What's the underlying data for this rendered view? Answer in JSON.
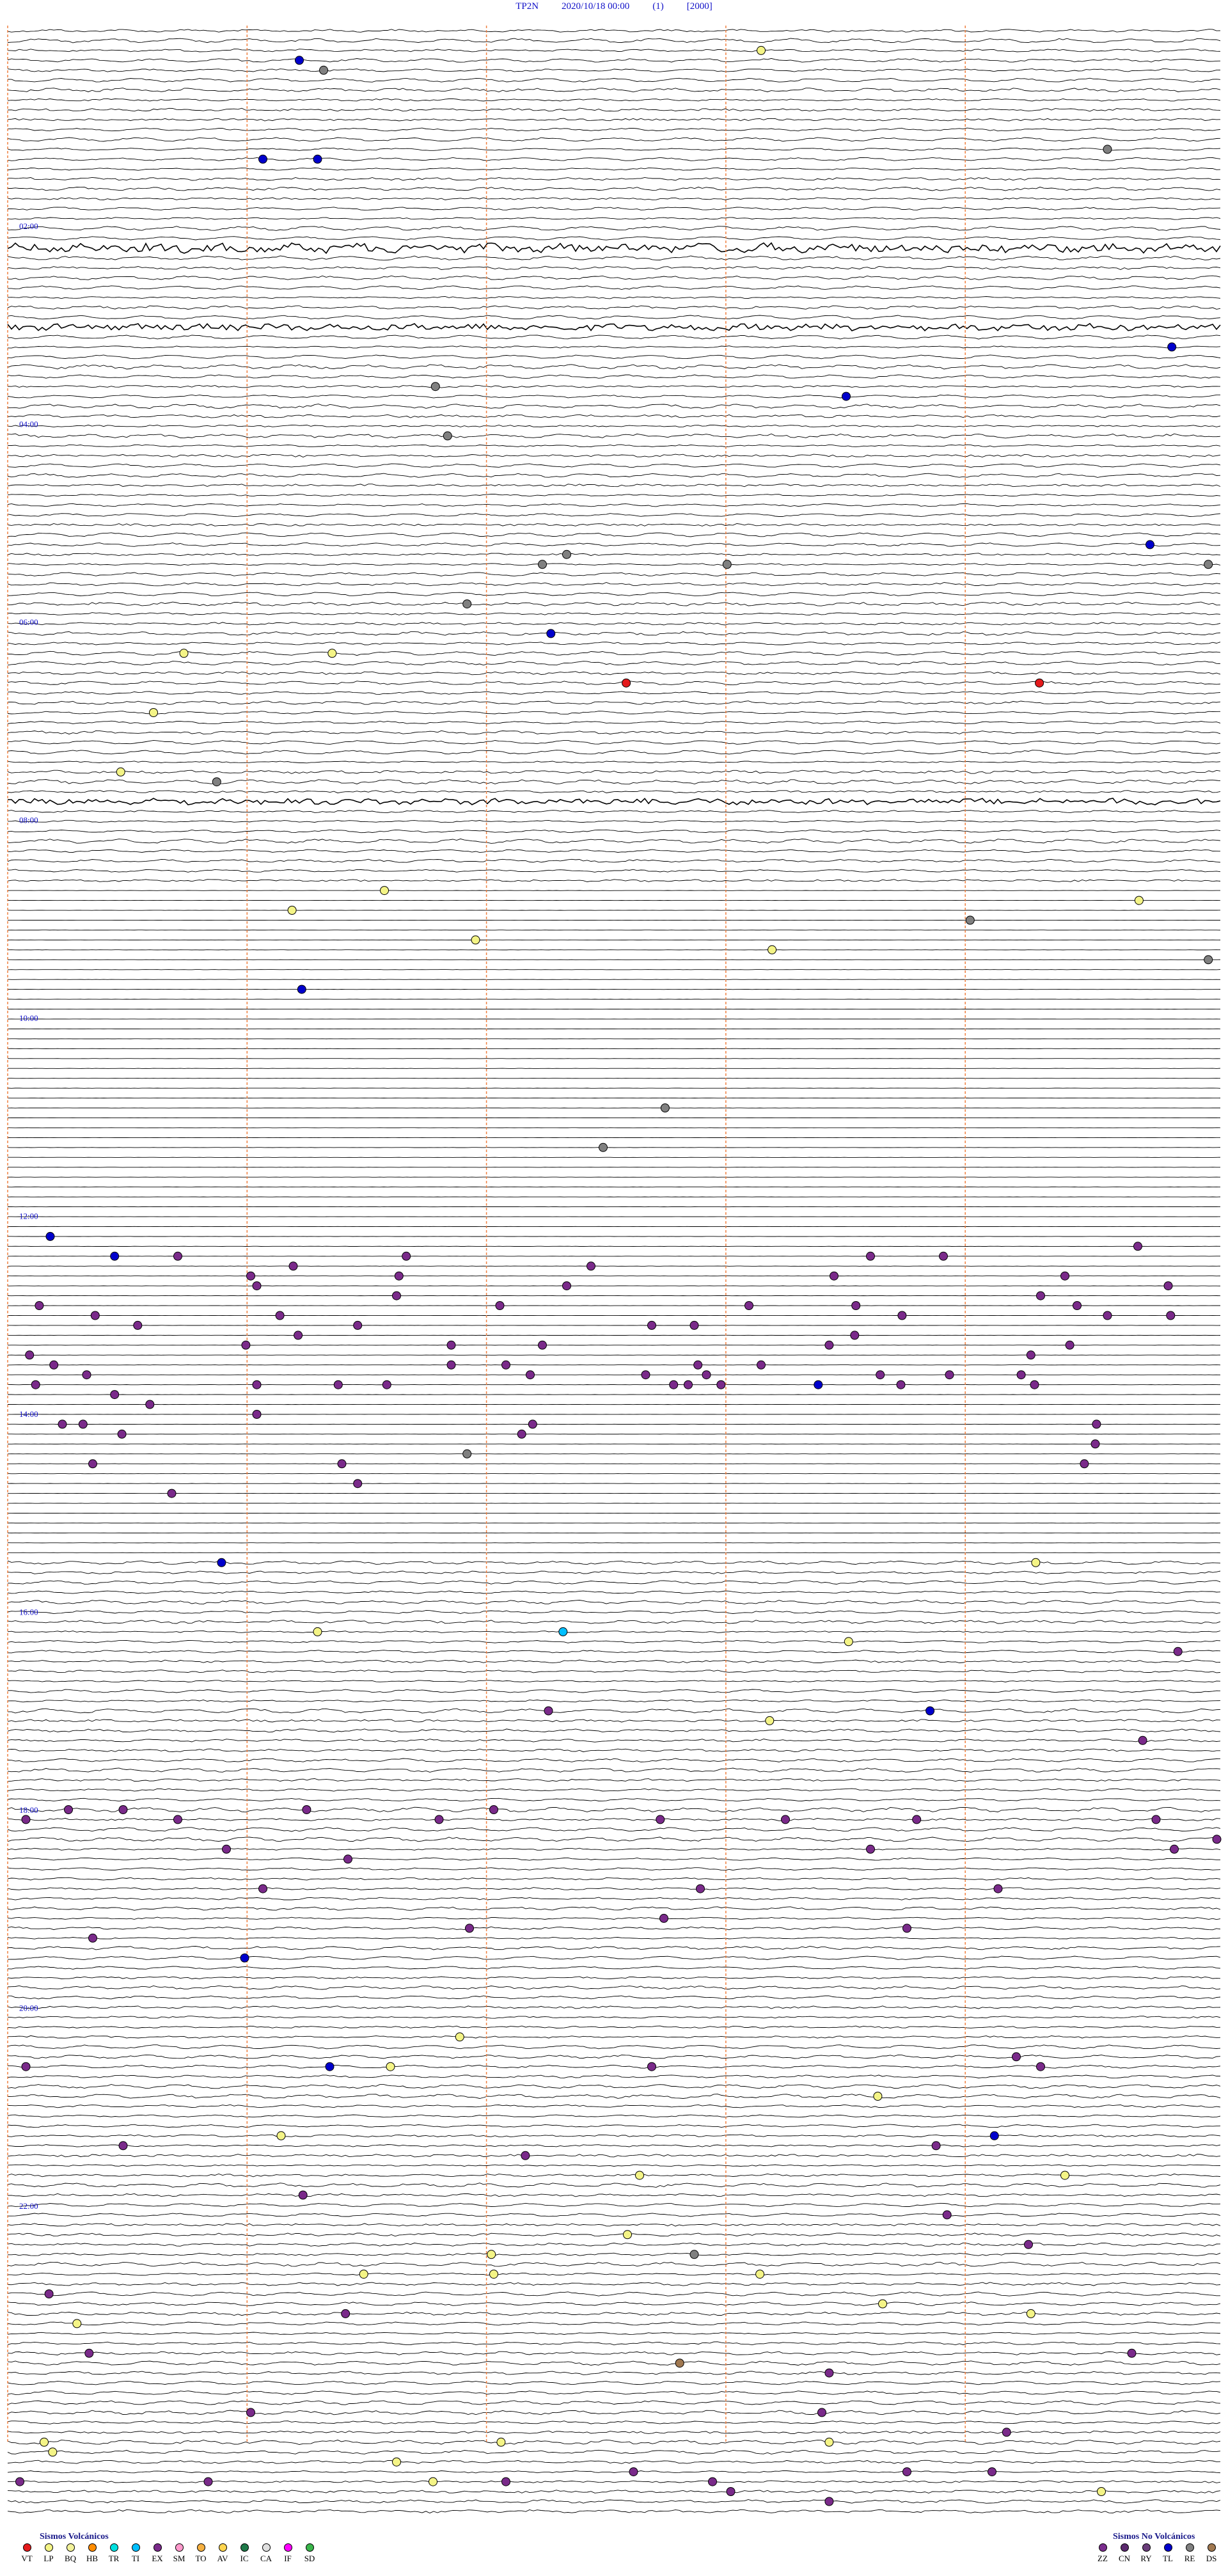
{
  "header": {
    "station": "TP2N",
    "datetime": "2020/10/18 00:00",
    "channel": "(1)",
    "scale": "[2000]"
  },
  "chart_data": {
    "type": "scatter",
    "title": "TP2N 2020/10/18 00:00 (1) [2000]",
    "hour_labels": [
      "02:00",
      "04:00",
      "06:00",
      "08:00",
      "10:00",
      "12:00",
      "14:00",
      "16:00",
      "18:00",
      "20:00",
      "22:00"
    ],
    "traces_per_hour": 10,
    "total_traces": 240,
    "event_types_colors": {
      "VT": "#e41a1c",
      "LP": "#f4f486",
      "BQ": "#f2f29a",
      "HB": "#ff8c00",
      "TR": "#00e0e0",
      "TI": "#00bfff",
      "EX": "#7a2a8a",
      "SM": "#ff99cc",
      "TO": "#f5b041",
      "AV": "#ffd54f",
      "IC": "#1f7a4a",
      "CA": "#e0e0e0",
      "IF": "#ff00ff",
      "SD": "#39b54a",
      "ZZ": "#7b2d8e",
      "CN": "#5b2a6e",
      "RY": "#6a3d7a",
      "TL": "#0000cc",
      "RE": "#808080",
      "DS": "#a07850"
    },
    "events": [
      {
        "type": "TL",
        "x": 0.24,
        "row": 3
      },
      {
        "type": "RE",
        "x": 0.26,
        "row": 4
      },
      {
        "type": "LP",
        "x": 0.62,
        "row": 2
      },
      {
        "type": "TL",
        "x": 0.21,
        "row": 13
      },
      {
        "type": "TL",
        "x": 0.255,
        "row": 13
      },
      {
        "type": "RE",
        "x": 0.905,
        "row": 12
      },
      {
        "type": "TL",
        "x": 0.958,
        "row": 32
      },
      {
        "type": "RE",
        "x": 0.352,
        "row": 36
      },
      {
        "type": "TL",
        "x": 0.69,
        "row": 37
      },
      {
        "type": "RE",
        "x": 0.362,
        "row": 41
      },
      {
        "type": "TL",
        "x": 0.94,
        "row": 52
      },
      {
        "type": "RE",
        "x": 0.44,
        "row": 54
      },
      {
        "type": "RE",
        "x": 0.592,
        "row": 54
      },
      {
        "type": "RE",
        "x": 0.46,
        "row": 53
      },
      {
        "type": "RE",
        "x": 0.988,
        "row": 54
      },
      {
        "type": "RE",
        "x": 0.378,
        "row": 58
      },
      {
        "type": "TL",
        "x": 0.447,
        "row": 61
      },
      {
        "type": "LP",
        "x": 0.145,
        "row": 63
      },
      {
        "type": "LP",
        "x": 0.267,
        "row": 63
      },
      {
        "type": "VT",
        "x": 0.509,
        "row": 66
      },
      {
        "type": "VT",
        "x": 0.849,
        "row": 66
      },
      {
        "type": "LP",
        "x": 0.12,
        "row": 69
      },
      {
        "type": "LP",
        "x": 0.093,
        "row": 75
      },
      {
        "type": "RE",
        "x": 0.172,
        "row": 76
      },
      {
        "type": "LP",
        "x": 0.31,
        "row": 87
      },
      {
        "type": "LP",
        "x": 0.931,
        "row": 88
      },
      {
        "type": "LP",
        "x": 0.234,
        "row": 89
      },
      {
        "type": "RE",
        "x": 0.792,
        "row": 90
      },
      {
        "type": "LP",
        "x": 0.385,
        "row": 92
      },
      {
        "type": "LP",
        "x": 0.629,
        "row": 93
      },
      {
        "type": "RE",
        "x": 0.988,
        "row": 94
      },
      {
        "type": "TL",
        "x": 0.242,
        "row": 97
      },
      {
        "type": "RE",
        "x": 0.541,
        "row": 109
      },
      {
        "type": "RE",
        "x": 0.49,
        "row": 113
      },
      {
        "type": "TL",
        "x": 0.035,
        "row": 122
      },
      {
        "type": "TL",
        "x": 0.088,
        "row": 124
      },
      {
        "type": "EX",
        "x": 0.14,
        "row": 124
      },
      {
        "type": "EX",
        "x": 0.235,
        "row": 125
      },
      {
        "type": "EX",
        "x": 0.328,
        "row": 124
      },
      {
        "type": "EX",
        "x": 0.48,
        "row": 125
      },
      {
        "type": "EX",
        "x": 0.71,
        "row": 124
      },
      {
        "type": "EX",
        "x": 0.77,
        "row": 124
      },
      {
        "type": "EX",
        "x": 0.93,
        "row": 123
      },
      {
        "type": "EX",
        "x": 0.026,
        "row": 129
      },
      {
        "type": "EX",
        "x": 0.072,
        "row": 130
      },
      {
        "type": "EX",
        "x": 0.2,
        "row": 126
      },
      {
        "type": "EX",
        "x": 0.322,
        "row": 126
      },
      {
        "type": "EX",
        "x": 0.205,
        "row": 127
      },
      {
        "type": "EX",
        "x": 0.32,
        "row": 128
      },
      {
        "type": "EX",
        "x": 0.46,
        "row": 127
      },
      {
        "type": "EX",
        "x": 0.68,
        "row": 126
      },
      {
        "type": "EX",
        "x": 0.87,
        "row": 126
      },
      {
        "type": "EX",
        "x": 0.955,
        "row": 127
      },
      {
        "type": "EX",
        "x": 0.85,
        "row": 128
      },
      {
        "type": "EX",
        "x": 0.61,
        "row": 129
      },
      {
        "type": "EX",
        "x": 0.698,
        "row": 129
      },
      {
        "type": "EX",
        "x": 0.88,
        "row": 129
      },
      {
        "type": "EX",
        "x": 0.405,
        "row": 129
      },
      {
        "type": "EX",
        "x": 0.224,
        "row": 130
      },
      {
        "type": "EX",
        "x": 0.107,
        "row": 131
      },
      {
        "type": "EX",
        "x": 0.288,
        "row": 131
      },
      {
        "type": "EX",
        "x": 0.53,
        "row": 131
      },
      {
        "type": "EX",
        "x": 0.565,
        "row": 131
      },
      {
        "type": "EX",
        "x": 0.736,
        "row": 130
      },
      {
        "type": "EX",
        "x": 0.905,
        "row": 130
      },
      {
        "type": "EX",
        "x": 0.957,
        "row": 130
      },
      {
        "type": "EX",
        "x": 0.018,
        "row": 134
      },
      {
        "type": "EX",
        "x": 0.196,
        "row": 133
      },
      {
        "type": "EX",
        "x": 0.239,
        "row": 132
      },
      {
        "type": "EX",
        "x": 0.365,
        "row": 133
      },
      {
        "type": "EX",
        "x": 0.44,
        "row": 133
      },
      {
        "type": "EX",
        "x": 0.676,
        "row": 133
      },
      {
        "type": "EX",
        "x": 0.697,
        "row": 132
      },
      {
        "type": "EX",
        "x": 0.874,
        "row": 133
      },
      {
        "type": "EX",
        "x": 0.842,
        "row": 134
      },
      {
        "type": "EX",
        "x": 0.038,
        "row": 135
      },
      {
        "type": "EX",
        "x": 0.065,
        "row": 136
      },
      {
        "type": "EX",
        "x": 0.365,
        "row": 135
      },
      {
        "type": "EX",
        "x": 0.41,
        "row": 135
      },
      {
        "type": "EX",
        "x": 0.568,
        "row": 135
      },
      {
        "type": "EX",
        "x": 0.62,
        "row": 135
      },
      {
        "type": "EX",
        "x": 0.43,
        "row": 136
      },
      {
        "type": "EX",
        "x": 0.525,
        "row": 136
      },
      {
        "type": "EX",
        "x": 0.575,
        "row": 136
      },
      {
        "type": "EX",
        "x": 0.718,
        "row": 136
      },
      {
        "type": "EX",
        "x": 0.775,
        "row": 136
      },
      {
        "type": "EX",
        "x": 0.834,
        "row": 136
      },
      {
        "type": "EX",
        "x": 0.023,
        "row": 137
      },
      {
        "type": "EX",
        "x": 0.088,
        "row": 138
      },
      {
        "type": "EX",
        "x": 0.117,
        "row": 139
      },
      {
        "type": "EX",
        "x": 0.205,
        "row": 137
      },
      {
        "type": "EX",
        "x": 0.272,
        "row": 137
      },
      {
        "type": "EX",
        "x": 0.312,
        "row": 137
      },
      {
        "type": "EX",
        "x": 0.548,
        "row": 137
      },
      {
        "type": "EX",
        "x": 0.56,
        "row": 137
      },
      {
        "type": "EX",
        "x": 0.587,
        "row": 137
      },
      {
        "type": "EX",
        "x": 0.735,
        "row": 137
      },
      {
        "type": "EX",
        "x": 0.845,
        "row": 137
      },
      {
        "type": "TL",
        "x": 0.667,
        "row": 137
      },
      {
        "type": "EX",
        "x": 0.045,
        "row": 141
      },
      {
        "type": "EX",
        "x": 0.062,
        "row": 141
      },
      {
        "type": "EX",
        "x": 0.094,
        "row": 142
      },
      {
        "type": "EX",
        "x": 0.205,
        "row": 140
      },
      {
        "type": "EX",
        "x": 0.432,
        "row": 141
      },
      {
        "type": "EX",
        "x": 0.423,
        "row": 142
      },
      {
        "type": "EX",
        "x": 0.896,
        "row": 141
      },
      {
        "type": "EX",
        "x": 0.895,
        "row": 143
      },
      {
        "type": "EX",
        "x": 0.07,
        "row": 145
      },
      {
        "type": "RE",
        "x": 0.378,
        "row": 144
      },
      {
        "type": "EX",
        "x": 0.275,
        "row": 145
      },
      {
        "type": "EX",
        "x": 0.886,
        "row": 145
      },
      {
        "type": "EX",
        "x": 0.288,
        "row": 147
      },
      {
        "type": "EX",
        "x": 0.135,
        "row": 148
      },
      {
        "type": "TL",
        "x": 0.176,
        "row": 155
      },
      {
        "type": "LP",
        "x": 0.846,
        "row": 155
      },
      {
        "type": "TI",
        "x": 0.457,
        "row": 162
      },
      {
        "type": "LP",
        "x": 0.255,
        "row": 162
      },
      {
        "type": "LP",
        "x": 0.692,
        "row": 163
      },
      {
        "type": "EX",
        "x": 0.963,
        "row": 164
      },
      {
        "type": "EX",
        "x": 0.445,
        "row": 170
      },
      {
        "type": "TL",
        "x": 0.759,
        "row": 170
      },
      {
        "type": "LP",
        "x": 0.627,
        "row": 171
      },
      {
        "type": "EX",
        "x": 0.934,
        "row": 173
      },
      {
        "type": "EX",
        "x": 0.015,
        "row": 181
      },
      {
        "type": "EX",
        "x": 0.05,
        "row": 180
      },
      {
        "type": "EX",
        "x": 0.095,
        "row": 180
      },
      {
        "type": "EX",
        "x": 0.14,
        "row": 181
      },
      {
        "type": "EX",
        "x": 0.246,
        "row": 180
      },
      {
        "type": "EX",
        "x": 0.355,
        "row": 181
      },
      {
        "type": "EX",
        "x": 0.4,
        "row": 180
      },
      {
        "type": "EX",
        "x": 0.537,
        "row": 181
      },
      {
        "type": "EX",
        "x": 0.64,
        "row": 181
      },
      {
        "type": "EX",
        "x": 0.748,
        "row": 181
      },
      {
        "type": "EX",
        "x": 0.945,
        "row": 181
      },
      {
        "type": "EX",
        "x": 0.995,
        "row": 183
      },
      {
        "type": "EX",
        "x": 0.18,
        "row": 184
      },
      {
        "type": "EX",
        "x": 0.28,
        "row": 185
      },
      {
        "type": "EX",
        "x": 0.71,
        "row": 184
      },
      {
        "type": "EX",
        "x": 0.96,
        "row": 184
      },
      {
        "type": "EX",
        "x": 0.21,
        "row": 188
      },
      {
        "type": "EX",
        "x": 0.57,
        "row": 188
      },
      {
        "type": "EX",
        "x": 0.815,
        "row": 188
      },
      {
        "type": "EX",
        "x": 0.54,
        "row": 191
      },
      {
        "type": "EX",
        "x": 0.74,
        "row": 192
      },
      {
        "type": "EX",
        "x": 0.07,
        "row": 193
      },
      {
        "type": "EX",
        "x": 0.38,
        "row": 192
      },
      {
        "type": "TL",
        "x": 0.195,
        "row": 195
      },
      {
        "type": "TL",
        "x": 0.265,
        "row": 206
      },
      {
        "type": "LP",
        "x": 0.315,
        "row": 206
      },
      {
        "type": "LP",
        "x": 0.372,
        "row": 203
      },
      {
        "type": "EX",
        "x": 0.83,
        "row": 205
      },
      {
        "type": "EX",
        "x": 0.015,
        "row": 206
      },
      {
        "type": "EX",
        "x": 0.53,
        "row": 206
      },
      {
        "type": "EX",
        "x": 0.85,
        "row": 206
      },
      {
        "type": "LP",
        "x": 0.716,
        "row": 209
      },
      {
        "type": "TL",
        "x": 0.812,
        "row": 213
      },
      {
        "type": "EX",
        "x": 0.764,
        "row": 214
      },
      {
        "type": "LP",
        "x": 0.225,
        "row": 213
      },
      {
        "type": "EX",
        "x": 0.095,
        "row": 214
      },
      {
        "type": "EX",
        "x": 0.426,
        "row": 215
      },
      {
        "type": "LP",
        "x": 0.87,
        "row": 217
      },
      {
        "type": "LP",
        "x": 0.52,
        "row": 217
      },
      {
        "type": "EX",
        "x": 0.243,
        "row": 219
      },
      {
        "type": "EX",
        "x": 0.773,
        "row": 221
      },
      {
        "type": "LP",
        "x": 0.51,
        "row": 223
      },
      {
        "type": "EX",
        "x": 0.84,
        "row": 224
      },
      {
        "type": "RE",
        "x": 0.565,
        "row": 225
      },
      {
        "type": "LP",
        "x": 0.398,
        "row": 225
      },
      {
        "type": "LP",
        "x": 0.619,
        "row": 227
      },
      {
        "type": "LP",
        "x": 0.293,
        "row": 227
      },
      {
        "type": "LP",
        "x": 0.4,
        "row": 227
      },
      {
        "type": "EX",
        "x": 0.034,
        "row": 229
      },
      {
        "type": "LP",
        "x": 0.72,
        "row": 230
      },
      {
        "type": "EX",
        "x": 0.278,
        "row": 231
      },
      {
        "type": "LP",
        "x": 0.842,
        "row": 231
      },
      {
        "type": "LP",
        "x": 0.057,
        "row": 232
      },
      {
        "type": "EX",
        "x": 0.067,
        "row": 235
      },
      {
        "type": "DS",
        "x": 0.553,
        "row": 236
      },
      {
        "type": "EX",
        "x": 0.925,
        "row": 235
      },
      {
        "type": "EX",
        "x": 0.676,
        "row": 237
      },
      {
        "type": "EX",
        "x": 0.2,
        "row": 241
      },
      {
        "type": "EX",
        "x": 0.67,
        "row": 241
      },
      {
        "type": "LP",
        "x": 0.03,
        "row": 244
      },
      {
        "type": "LP",
        "x": 0.037,
        "row": 245
      },
      {
        "type": "LP",
        "x": 0.32,
        "row": 246
      },
      {
        "type": "LP",
        "x": 0.406,
        "row": 244
      },
      {
        "type": "LP",
        "x": 0.676,
        "row": 244
      },
      {
        "type": "EX",
        "x": 0.822,
        "row": 243
      },
      {
        "type": "LP",
        "x": 0.35,
        "row": 248
      },
      {
        "type": "EX",
        "x": 0.165,
        "row": 248
      },
      {
        "type": "EX",
        "x": 0.01,
        "row": 248
      },
      {
        "type": "EX",
        "x": 0.41,
        "row": 248
      },
      {
        "type": "EX",
        "x": 0.515,
        "row": 247
      },
      {
        "type": "EX",
        "x": 0.58,
        "row": 248
      },
      {
        "type": "EX",
        "x": 0.595,
        "row": 249
      },
      {
        "type": "EX",
        "x": 0.74,
        "row": 247
      },
      {
        "type": "EX",
        "x": 0.81,
        "row": 247
      },
      {
        "type": "LP",
        "x": 0.9,
        "row": 249
      },
      {
        "type": "EX",
        "x": 0.676,
        "row": 250
      }
    ]
  },
  "legend": {
    "volcanic_title": "Sismos Volcánicos",
    "volcanic": [
      {
        "code": "VT",
        "color": "#e41a1c"
      },
      {
        "code": "LP",
        "color": "#f4f486"
      },
      {
        "code": "BQ",
        "color": "#f2f29a"
      },
      {
        "code": "HB",
        "color": "#ff8c00"
      },
      {
        "code": "TR",
        "color": "#00e0e0"
      },
      {
        "code": "TI",
        "color": "#00bfff"
      },
      {
        "code": "EX",
        "color": "#7a2a8a"
      },
      {
        "code": "SM",
        "color": "#ff99cc"
      },
      {
        "code": "TO",
        "color": "#f5b041"
      },
      {
        "code": "AV",
        "color": "#ffd54f"
      },
      {
        "code": "IC",
        "color": "#1f7a4a"
      },
      {
        "code": "CA",
        "color": "#e0e0e0"
      },
      {
        "code": "IF",
        "color": "#ff00ff"
      },
      {
        "code": "SD",
        "color": "#39b54a"
      }
    ],
    "nonvolcanic_title": "Sismos No Volcánicos",
    "nonvolcanic": [
      {
        "code": "ZZ",
        "color": "#7b2d8e"
      },
      {
        "code": "CN",
        "color": "#5b2a6e"
      },
      {
        "code": "RY",
        "color": "#6a3d7a"
      },
      {
        "code": "TL",
        "color": "#0000cc"
      },
      {
        "code": "RE",
        "color": "#808080"
      },
      {
        "code": "DS",
        "color": "#a07850"
      }
    ]
  }
}
